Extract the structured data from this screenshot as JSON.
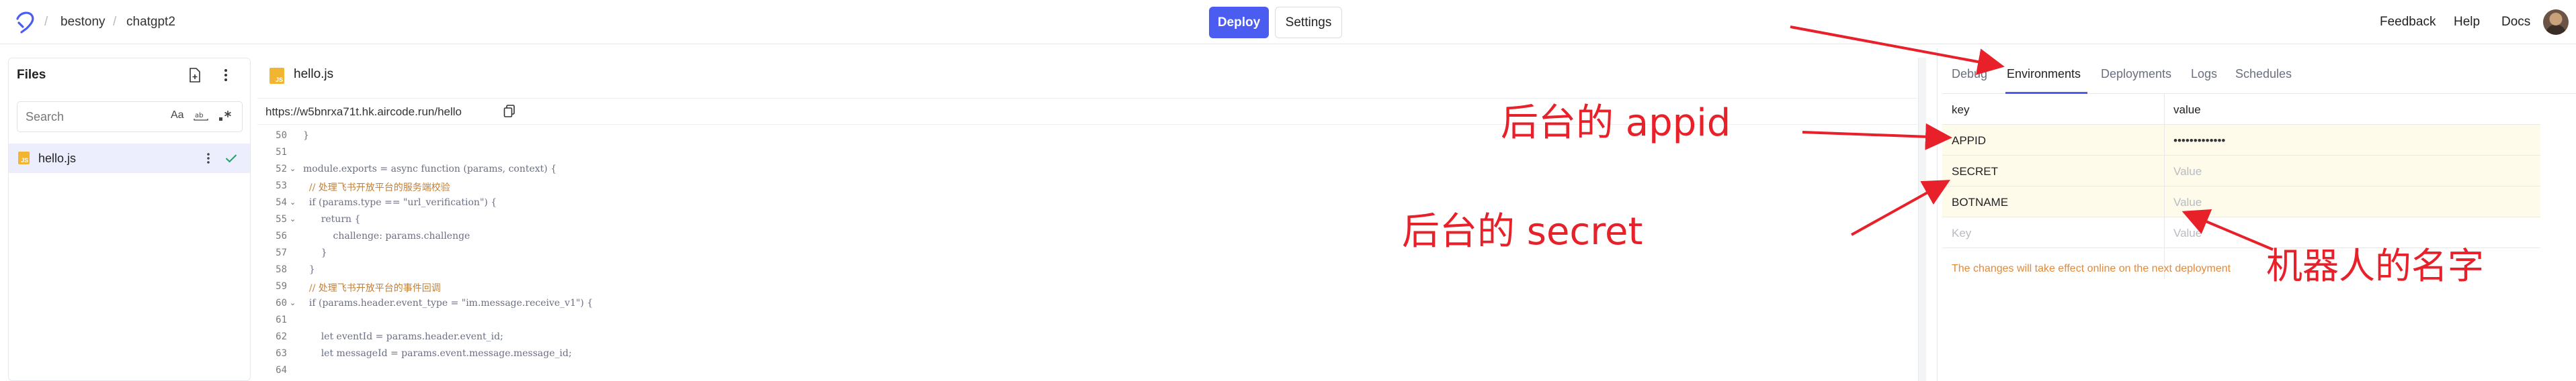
{
  "header": {
    "breadcrumb": [
      "bestony",
      "chatgpt2"
    ],
    "deploy_label": "Deploy",
    "settings_label": "Settings",
    "links": [
      "Feedback",
      "Help",
      "Docs"
    ]
  },
  "files_panel": {
    "title": "Files",
    "search_placeholder": "Search",
    "search_tools": [
      "Aa"
    ],
    "files": [
      {
        "name": "hello.js",
        "icon": "js-file-icon"
      }
    ]
  },
  "editor": {
    "tab_label": "hello.js",
    "url": "https://w5bnrxa71t.hk.aircode.run/hello",
    "lines": [
      {
        "n": "50",
        "text": "}",
        "fold": false
      },
      {
        "n": "51",
        "text": "",
        "fold": false
      },
      {
        "n": "52",
        "text": "module.exports = async function (params, context) {",
        "fold": true
      },
      {
        "n": "53",
        "text": "  // 处理飞书开放平台的服务端校验",
        "fold": false
      },
      {
        "n": "54",
        "text": "  if (params.type == \"url_verification\") {",
        "fold": true
      },
      {
        "n": "55",
        "text": "      return {",
        "fold": true
      },
      {
        "n": "56",
        "text": "          challenge: params.challenge",
        "fold": false
      },
      {
        "n": "57",
        "text": "      }",
        "fold": false
      },
      {
        "n": "58",
        "text": "  }",
        "fold": false
      },
      {
        "n": "59",
        "text": "  // 处理飞书开放平台的事件回调",
        "fold": false
      },
      {
        "n": "60",
        "text": "  if (params.header.event_type = \"im.message.receive_v1\") {",
        "fold": true
      },
      {
        "n": "61",
        "text": "",
        "fold": false
      },
      {
        "n": "62",
        "text": "      let eventId = params.header.event_id;",
        "fold": false
      },
      {
        "n": "63",
        "text": "      let messageId = params.event.message.message_id;",
        "fold": false
      },
      {
        "n": "64",
        "text": "",
        "fold": false
      }
    ]
  },
  "env_panel": {
    "tabs": [
      "Debug",
      "Environments",
      "Deployments",
      "Logs",
      "Schedules"
    ],
    "active_tab": "Environments",
    "columns": [
      "key",
      "value"
    ],
    "rows": [
      {
        "key": "APPID",
        "value": "•••••••••••••"
      },
      {
        "key": "SECRET",
        "value": "Value"
      },
      {
        "key": "BOTNAME",
        "value": "Value"
      }
    ],
    "new_key_placeholder": "Key",
    "new_value_placeholder": "Value",
    "note": "The changes will take effect online on the next deployment"
  },
  "annotations": {
    "appid": "后台的 appid",
    "secret": "后台的 secret",
    "botname": "机器人的名字"
  },
  "colors": {
    "accent": "#4b5cf0",
    "annotation": "#e8202a",
    "note": "#e08a3a",
    "row_highlight": "#fffbea"
  }
}
